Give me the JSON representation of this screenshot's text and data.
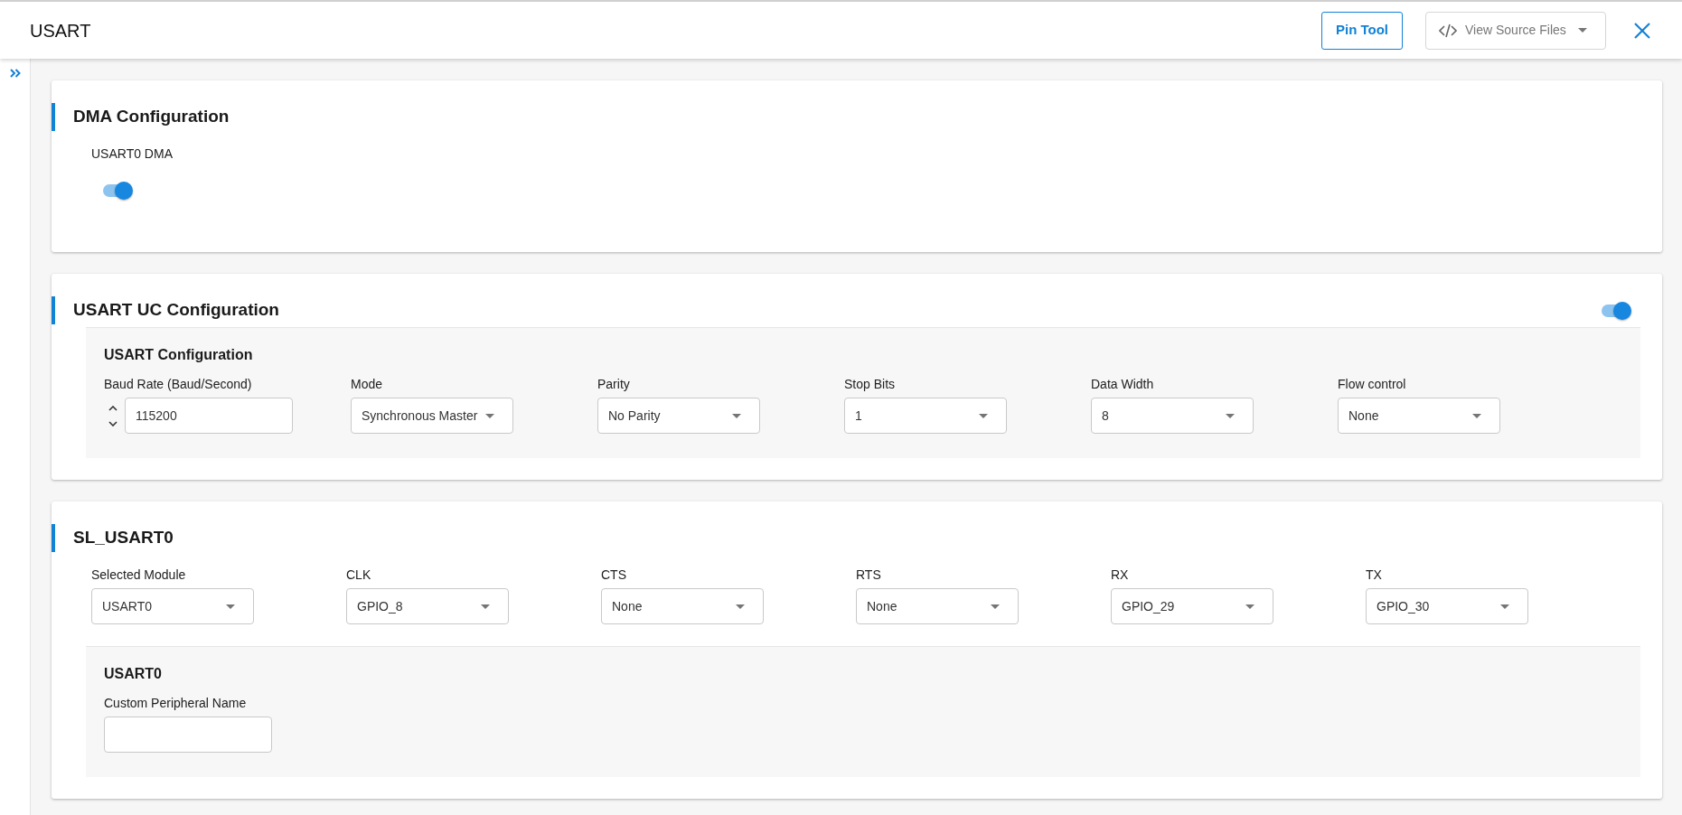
{
  "header": {
    "title": "USART",
    "pin_tool_button": "Pin Tool",
    "source_files_dropdown": "View Source Files"
  },
  "sections": [
    {
      "title": "DMA Configuration",
      "toggles": [
        {
          "label": "USART0 DMA",
          "on": true
        }
      ]
    },
    {
      "title": "USART UC Configuration",
      "toggle": {
        "on": true
      },
      "groups": [
        {
          "title": "USART Configuration",
          "fields": [
            {
              "kind": "number",
              "label": "Baud Rate (Baud/Second)",
              "value": "115200"
            },
            {
              "kind": "select",
              "label": "Mode",
              "value": "Synchronous Master"
            },
            {
              "kind": "select",
              "label": "Parity",
              "value": "No Parity"
            },
            {
              "kind": "select",
              "label": "Stop Bits",
              "value": "1"
            },
            {
              "kind": "select",
              "label": "Data Width",
              "value": "8"
            },
            {
              "kind": "select",
              "label": "Flow control",
              "value": "None"
            }
          ]
        }
      ]
    },
    {
      "title": "SL_USART0",
      "fields": [
        {
          "kind": "select",
          "label": "Selected Module",
          "value": "USART0"
        },
        {
          "kind": "select",
          "label": "CLK",
          "value": "GPIO_8"
        },
        {
          "kind": "select",
          "label": "CTS",
          "value": "None"
        },
        {
          "kind": "select",
          "label": "RTS",
          "value": "None"
        },
        {
          "kind": "select",
          "label": "RX",
          "value": "GPIO_29"
        },
        {
          "kind": "select",
          "label": "TX",
          "value": "GPIO_30"
        }
      ],
      "groups": [
        {
          "title": "USART0",
          "fields": [
            {
              "kind": "text",
              "label": "Custom Peripheral Name"
            }
          ]
        }
      ]
    }
  ]
}
